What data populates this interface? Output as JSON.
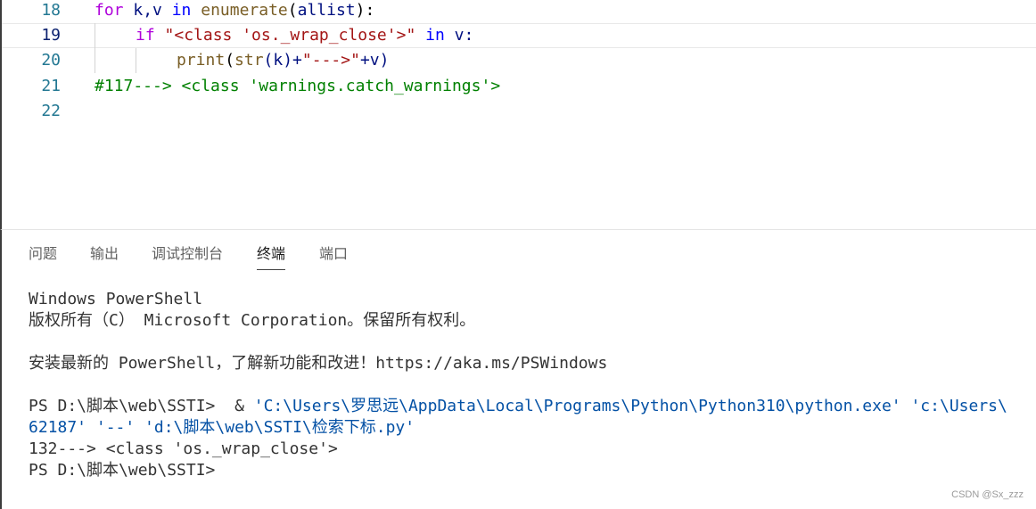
{
  "editor": {
    "lines": [
      {
        "number": "18",
        "parts": [
          "for",
          " k,v ",
          "in",
          " ",
          "enumerate",
          "(",
          "allist",
          "):"
        ]
      },
      {
        "number": "19",
        "parts": [
          "if",
          " \"<class 'os._wrap_close'>\" ",
          "in",
          " v:"
        ]
      },
      {
        "number": "20",
        "parts": [
          "print",
          "(",
          "str",
          "(k)+",
          "\"--->\"",
          "+v)"
        ]
      },
      {
        "number": "21",
        "parts": [
          "#117---> <class 'warnings.catch_warnings'>"
        ]
      },
      {
        "number": "22",
        "parts": []
      }
    ]
  },
  "panel": {
    "tabs": [
      "问题",
      "输出",
      "调试控制台",
      "终端",
      "端口"
    ],
    "active_tab": "终端"
  },
  "terminal": {
    "lines": [
      "Windows PowerShell",
      "版权所有（C） Microsoft Corporation。保留所有权利。",
      "",
      "安装最新的 PowerShell，了解新功能和改进！https://aka.ms/PSWindows",
      "",
      "PS D:\\脚本\\web\\SSTI>  & ",
      "'C:\\Users\\罗思远\\AppData\\Local\\Programs\\Python\\Python310\\python.exe' 'c:\\Users\\",
      "62187' '--' 'd:\\脚本\\web\\SSTI\\检索下标.py'",
      "132---> <class 'os._wrap_close'>",
      "PS D:\\脚本\\web\\SSTI>"
    ]
  },
  "watermark": "CSDN @Sx_zzz",
  "colors": {
    "line_number": "#237893",
    "keyword_blue": "#0000ff",
    "keyword_purple": "#af00db",
    "function": "#795e26",
    "variable": "#001080",
    "string": "#a31515",
    "comment": "#008000",
    "terminal_string": "#0451a5"
  }
}
